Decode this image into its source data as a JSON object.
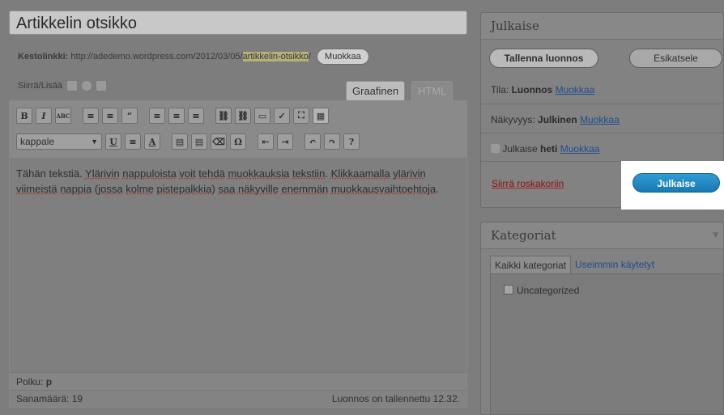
{
  "editor": {
    "title": "Artikkelin otsikko",
    "permalink_label": "Kestolinkki:",
    "permalink_base": "http://adedemo.wordpress.com/2012/03/05/",
    "permalink_slug": "artikkelin-otsikko",
    "permalink_suffix": "/",
    "permalink_edit": "Muokkaa",
    "upload_label": "Siirrä/Lisää",
    "tab_visual": "Graafinen",
    "tab_html": "HTML",
    "format_select": "kappale",
    "content_parts": [
      {
        "t": "Tähän tekstiä. ",
        "sp": false
      },
      {
        "t": "Ylärivin",
        "sp": true
      },
      {
        "t": " ",
        "sp": false
      },
      {
        "t": "nappuloista",
        "sp": true
      },
      {
        "t": " ",
        "sp": false
      },
      {
        "t": "voit",
        "sp": true
      },
      {
        "t": " ",
        "sp": false
      },
      {
        "t": "tehdä",
        "sp": true
      },
      {
        "t": " ",
        "sp": false
      },
      {
        "t": "muokkauksia",
        "sp": true
      },
      {
        "t": " ",
        "sp": false
      },
      {
        "t": "tekstiin",
        "sp": true
      },
      {
        "t": ". ",
        "sp": false
      },
      {
        "t": "Klikkaamalla",
        "sp": true
      },
      {
        "t": " ",
        "sp": false
      },
      {
        "t": "ylärivin",
        "sp": true
      },
      {
        "t": " ",
        "sp": false
      },
      {
        "t": "viimeistä",
        "sp": true
      },
      {
        "t": " ",
        "sp": false
      },
      {
        "t": "nappia",
        "sp": true
      },
      {
        "t": " (",
        "sp": false
      },
      {
        "t": "jossa",
        "sp": true
      },
      {
        "t": " ",
        "sp": false
      },
      {
        "t": "kolme",
        "sp": true
      },
      {
        "t": " ",
        "sp": false
      },
      {
        "t": "pistepalkkia",
        "sp": true
      },
      {
        "t": ") ",
        "sp": false
      },
      {
        "t": "saa",
        "sp": true
      },
      {
        "t": " ",
        "sp": false
      },
      {
        "t": "näkyville",
        "sp": true
      },
      {
        "t": " ",
        "sp": false
      },
      {
        "t": "enemmän",
        "sp": true
      },
      {
        "t": " ",
        "sp": false
      },
      {
        "t": "muokkausvaihtoehtoja",
        "sp": true
      },
      {
        "t": ".",
        "sp": false
      }
    ],
    "path_label": "Polku:",
    "path_value": "p",
    "word_count_label": "Sanamäärä: 19",
    "draft_saved": "Luonnos on tallennettu 12.32."
  },
  "toolbar": {
    "row1": [
      "B",
      "I",
      "ABC",
      "≡",
      "≡",
      "“",
      "≡",
      "≡",
      "≡",
      "⛓",
      "⛓",
      "▭",
      "✓",
      "⛶",
      "▦"
    ],
    "row2": [
      "U",
      "≡",
      "A",
      "▤",
      "▤",
      "⌫",
      "Ω",
      "⇤",
      "⇥",
      "↶",
      "↷",
      "?"
    ]
  },
  "publish": {
    "title": "Julkaise",
    "save_draft": "Tallenna luonnos",
    "preview": "Esikatsele",
    "status_label": "Tila:",
    "status_value": "Luonnos",
    "visibility_label": "Näkyvyys:",
    "visibility_value": "Julkinen",
    "schedule_label": "Julkaise",
    "schedule_value": "heti",
    "edit_link": "Muokkaa",
    "trash": "Siirrä roskakoriin",
    "publish_button": "Julkaise"
  },
  "categories": {
    "title": "Kategoriat",
    "tab_all": "Kaikki kategoriat",
    "tab_popular": "Useimmin käytetyt",
    "items": [
      "Uncategorized"
    ]
  }
}
